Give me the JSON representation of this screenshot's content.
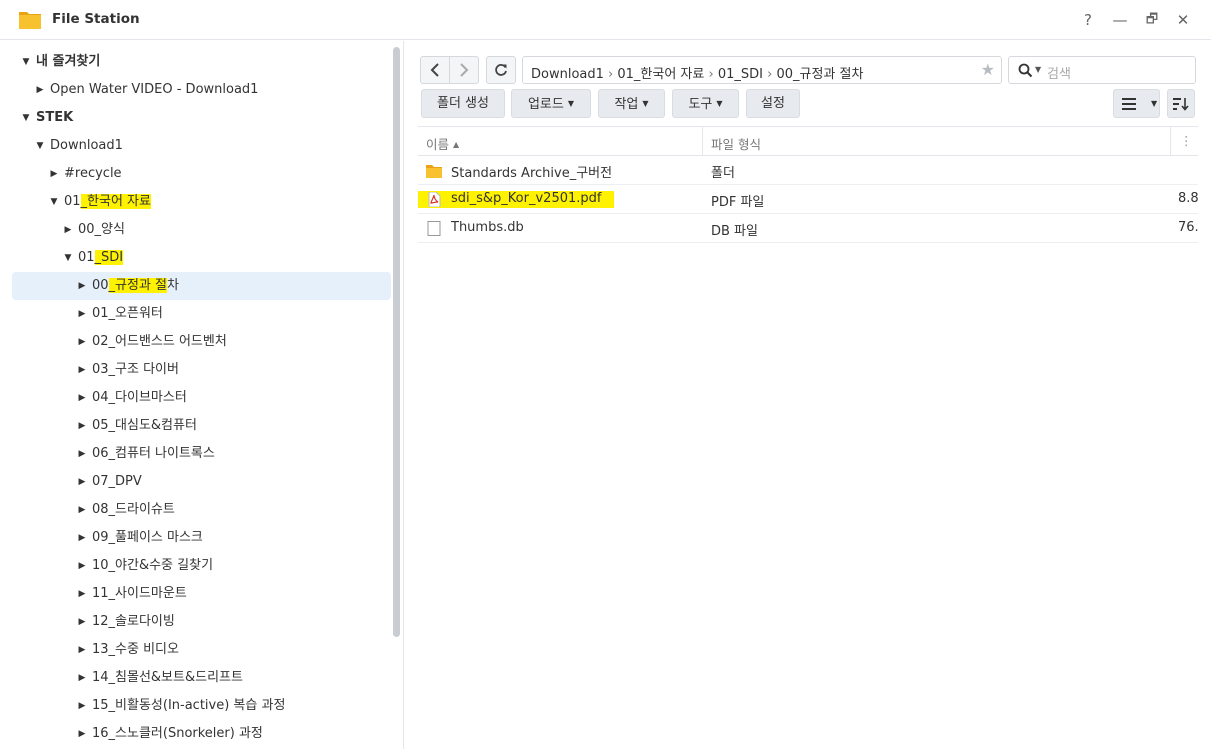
{
  "window": {
    "title": "File Station",
    "buttons": {
      "help": "?",
      "minimize": "—",
      "restore": "🗗",
      "close": "✕"
    }
  },
  "tree": {
    "items": [
      {
        "label": "내 즐겨찾기",
        "expanded": true
      },
      {
        "label": "Open Water VIDEO - Download1",
        "expanded": false
      },
      {
        "label": "STEK",
        "expanded": true
      },
      {
        "label": "Download1",
        "expanded": true
      },
      {
        "label": "#recycle",
        "expanded": false
      },
      {
        "label_prefix": "01",
        "label_highlight": "_한국어 자료",
        "expanded": true
      },
      {
        "label": "00_양식",
        "expanded": false
      },
      {
        "label_prefix": "01",
        "label_highlight": "_SDI",
        "expanded": true
      },
      {
        "label_prefix": "00",
        "label_highlight": "_규정과 절",
        "label_suffix": "차",
        "expanded": false,
        "selected": true
      },
      {
        "label": "01_오픈워터",
        "expanded": false
      },
      {
        "label": "02_어드밴스드 어드벤처",
        "expanded": false
      },
      {
        "label": "03_구조 다이버",
        "expanded": false
      },
      {
        "label": "04_다이브마스터",
        "expanded": false
      },
      {
        "label": "05_대심도&컴퓨터",
        "expanded": false
      },
      {
        "label": "06_컴퓨터 나이트록스",
        "expanded": false
      },
      {
        "label": "07_DPV",
        "expanded": false
      },
      {
        "label": "08_드라이슈트",
        "expanded": false
      },
      {
        "label": "09_풀페이스 마스크",
        "expanded": false
      },
      {
        "label": "10_야간&수중 길찾기",
        "expanded": false
      },
      {
        "label": "11_사이드마운트",
        "expanded": false
      },
      {
        "label": "12_솔로다이빙",
        "expanded": false
      },
      {
        "label": "13_수중 비디오",
        "expanded": false
      },
      {
        "label": "14_침몰선&보트&드리프트",
        "expanded": false
      },
      {
        "label": "15_비활동성(In-active) 복습 과정",
        "expanded": false
      },
      {
        "label": "16_스노클러(Snorkeler) 과정",
        "expanded": false
      }
    ]
  },
  "path": {
    "crumbs": [
      "Download1",
      "01_한국어 자료",
      "01_SDI",
      "00_규정과 절차"
    ],
    "separator": "›"
  },
  "search": {
    "placeholder": "검색"
  },
  "toolbar": {
    "create_folder": "폴더 생성",
    "upload": "업로드",
    "action": "작업",
    "tools": "도구",
    "settings": "설정"
  },
  "list": {
    "columns": {
      "name": "이름",
      "type": "파일 형식"
    },
    "files": [
      {
        "name": "Standards Archive_구버전",
        "type": "폴더",
        "size": "",
        "icon": "folder-icon"
      },
      {
        "name": "sdi_s&p_Kor_v2501.pdf",
        "type": "PDF 파일",
        "size": "8.8",
        "icon": "pdf-icon",
        "highlighted": true
      },
      {
        "name": "Thumbs.db",
        "type": "DB 파일",
        "size": "76.",
        "icon": "file-icon"
      }
    ]
  },
  "colors": {
    "highlight": "#fff200",
    "selected_row": "#e6f0fb",
    "folder": "#f6b93b",
    "pdf": "#d9342b"
  }
}
